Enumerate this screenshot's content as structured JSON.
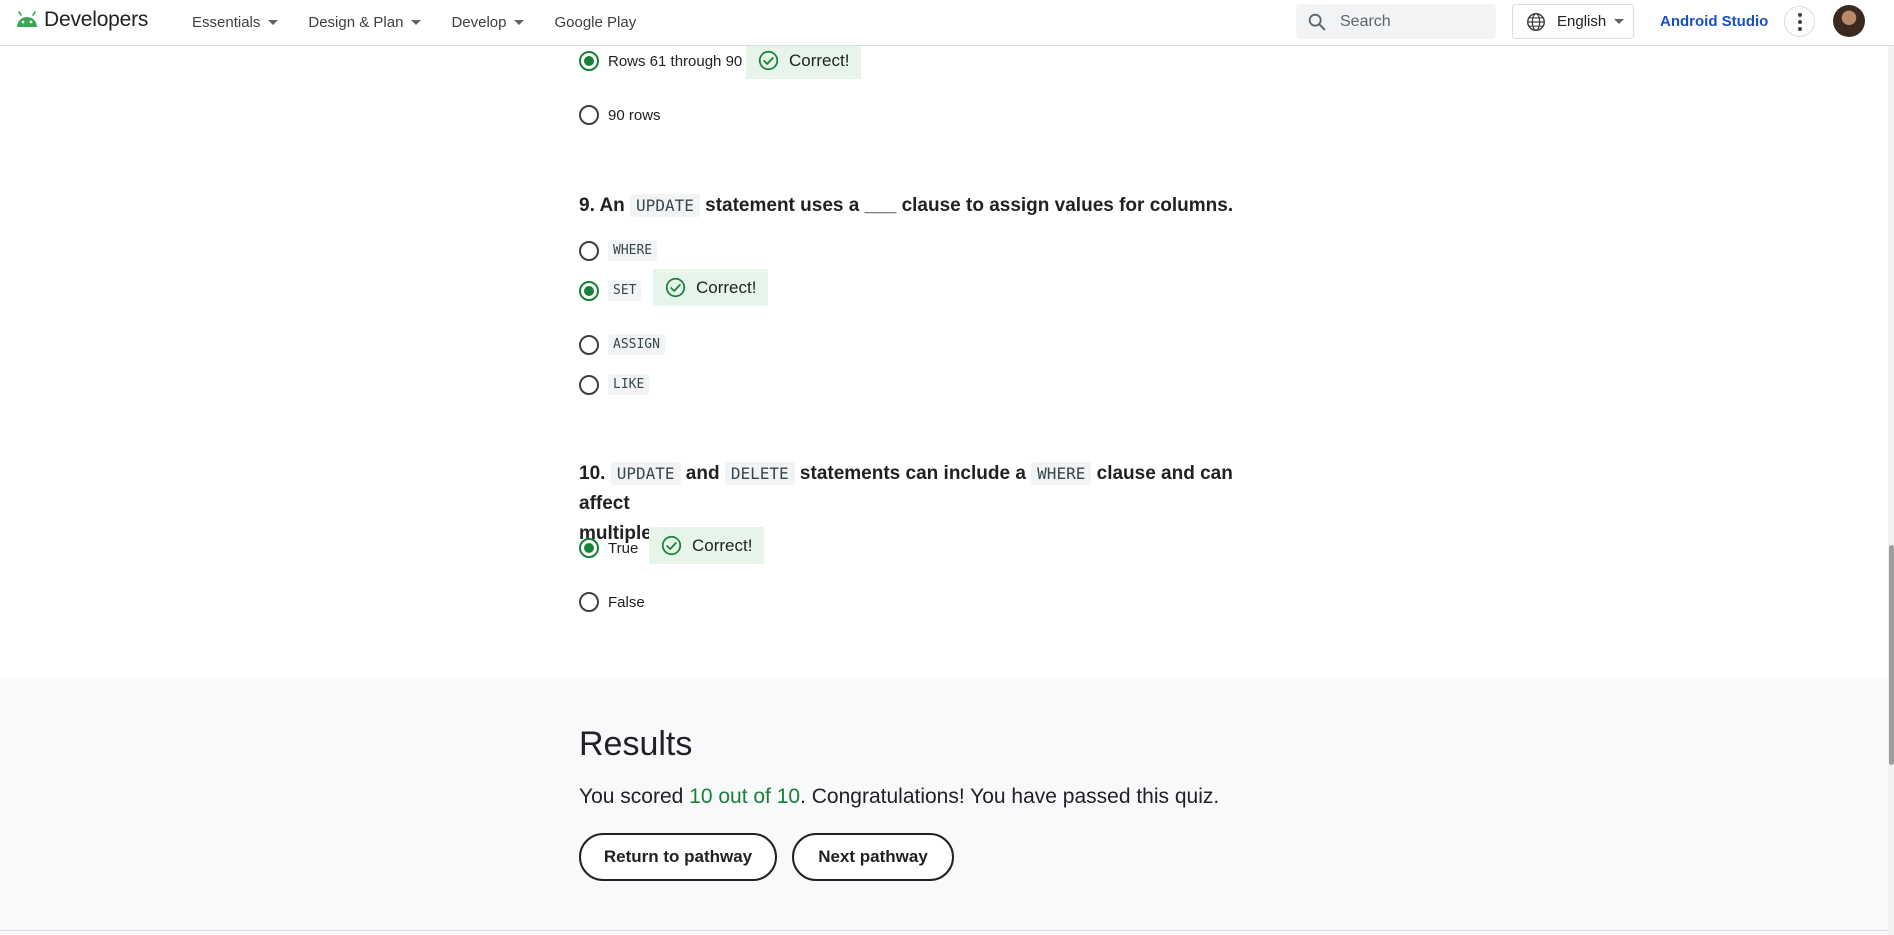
{
  "header": {
    "logo_text": "Developers",
    "nav": [
      {
        "label": "Essentials",
        "has_dropdown": true
      },
      {
        "label": "Design & Plan",
        "has_dropdown": true
      },
      {
        "label": "Develop",
        "has_dropdown": true
      },
      {
        "label": "Google Play",
        "has_dropdown": false
      }
    ],
    "search_placeholder": "Search",
    "language": "English",
    "android_studio": "Android Studio"
  },
  "q8": {
    "options": [
      {
        "label": "Rows 61 through 90",
        "checked": true,
        "feedback": "Correct!"
      },
      {
        "label": "90 rows",
        "checked": false
      }
    ]
  },
  "q9": {
    "number": "9.",
    "text_a": "An",
    "code_a": "UPDATE",
    "text_b": "statement uses a ___ clause to assign values for columns.",
    "options": [
      {
        "label": "WHERE",
        "checked": false
      },
      {
        "label": "SET",
        "checked": true,
        "feedback": "Correct!"
      },
      {
        "label": "ASSIGN",
        "checked": false
      },
      {
        "label": "LIKE",
        "checked": false
      }
    ]
  },
  "q10": {
    "number": "10.",
    "code_a": "UPDATE",
    "text_a": "and",
    "code_b": "DELETE",
    "text_b": "statements can include a",
    "code_c": "WHERE",
    "text_c": "clause and can affect",
    "text_d": "multiple rows.",
    "options": [
      {
        "label": "True",
        "checked": true,
        "feedback": "Correct!"
      },
      {
        "label": "False",
        "checked": false
      }
    ]
  },
  "results": {
    "title": "Results",
    "prefix": "You scored",
    "score": "10 out of 10",
    "suffix": ". Congratulations! You have passed this quiz.",
    "return_button": "Return to pathway",
    "next_button": "Next pathway"
  },
  "colors": {
    "accent_green": "#188038",
    "correct_bg": "#e6f4ea",
    "link_blue": "#1a4fbf"
  }
}
